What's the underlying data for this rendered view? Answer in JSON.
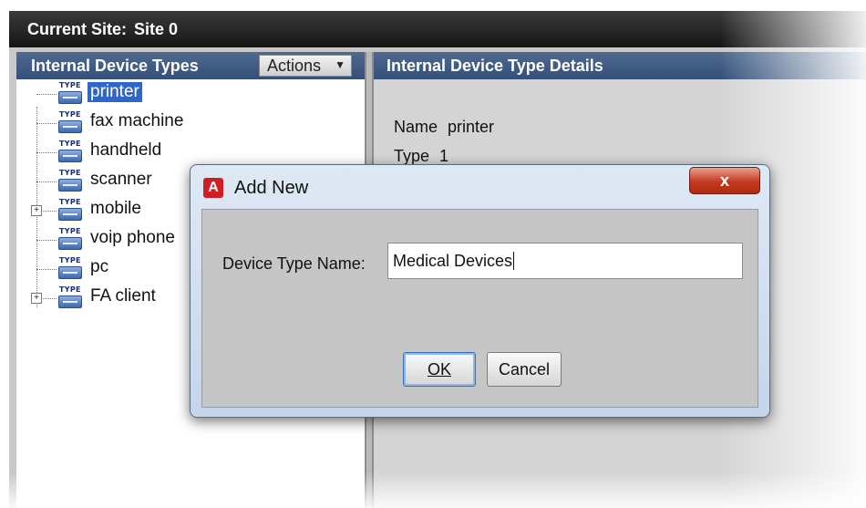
{
  "site_bar": {
    "label": "Current Site:",
    "value": "Site 0"
  },
  "left_panel": {
    "title": "Internal Device Types",
    "actions_label": "Actions",
    "tree": [
      {
        "label": "printer",
        "selected": true,
        "expandable": false
      },
      {
        "label": "fax machine",
        "selected": false,
        "expandable": false
      },
      {
        "label": "handheld",
        "selected": false,
        "expandable": false
      },
      {
        "label": "scanner",
        "selected": false,
        "expandable": false
      },
      {
        "label": "mobile",
        "selected": false,
        "expandable": true
      },
      {
        "label": "voip phone",
        "selected": false,
        "expandable": false
      },
      {
        "label": "pc",
        "selected": false,
        "expandable": false
      },
      {
        "label": "FA client",
        "selected": false,
        "expandable": true
      }
    ],
    "icon_tag": "TYPE",
    "icon": "device-type-icon"
  },
  "right_panel": {
    "title": "Internal Device Type Details",
    "name_label": "Name",
    "name_value": "printer",
    "type_label": "Type",
    "type_value": "1"
  },
  "dialog": {
    "title": "Add New",
    "app_icon_text": "A",
    "close_label": "x",
    "field_label": "Device Type Name:",
    "field_value": "Medical Devices",
    "ok_label": "OK",
    "cancel_label": "Cancel"
  },
  "colors": {
    "selected_bg": "#2f66c8",
    "header_bg": "#3f5b82",
    "close_button": "#c43a20"
  }
}
